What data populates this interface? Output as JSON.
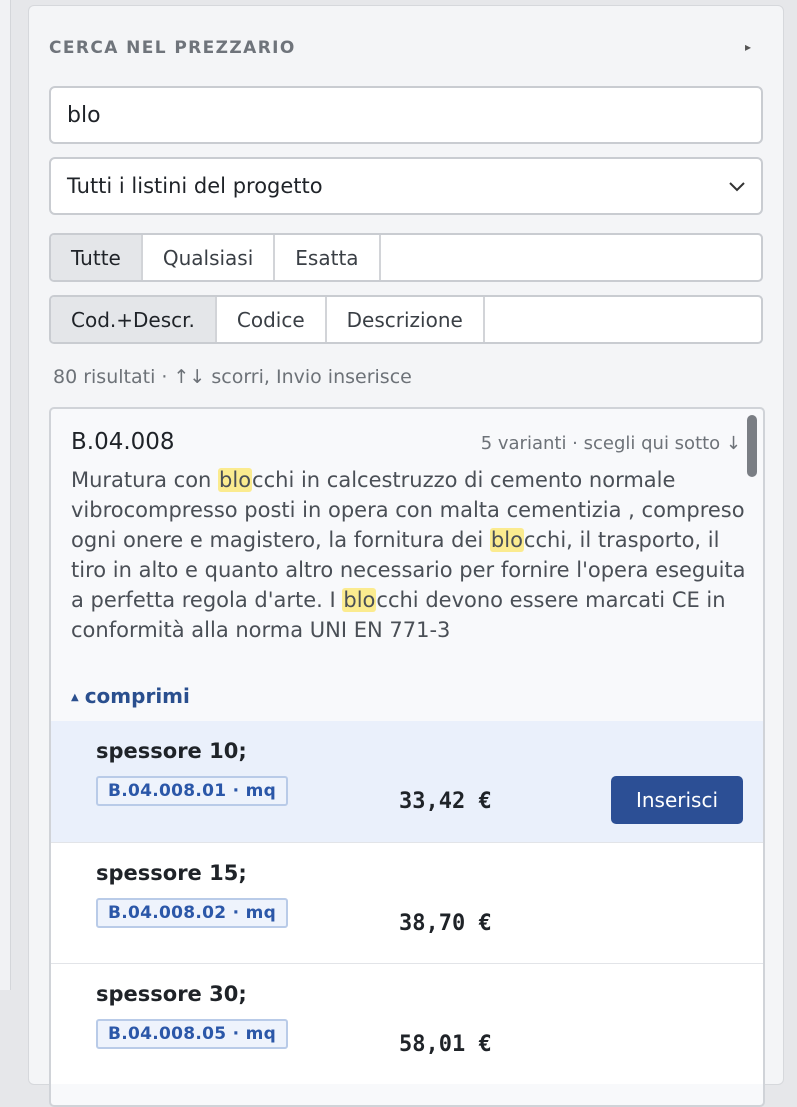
{
  "panel": {
    "title": "CERCA NEL PREZZARIO",
    "toggle_icon": "▸"
  },
  "search": {
    "value": "blo"
  },
  "listino_select": {
    "selected": "Tutti i listini del progetto"
  },
  "match_mode": {
    "options": [
      "Tutte",
      "Qualsiasi",
      "Esatta"
    ],
    "active": "Tutte"
  },
  "search_field": {
    "options": [
      "Cod.+Descr.",
      "Codice",
      "Descrizione"
    ],
    "active": "Cod.+Descr."
  },
  "results": {
    "summary": "80 risultati · ↑↓ scorri, Invio inserisce"
  },
  "item": {
    "code": "B.04.008",
    "variants_hint": "5 varianti · scegli qui sotto ↓",
    "desc_parts": [
      "Muratura con ",
      "blo",
      "cchi in calcestruzzo di cemento normale vibrocompresso posti in opera con malta cementizia , compreso ogni onere e magistero, la fornitura dei ",
      "blo",
      "cchi, il trasporto, il tiro in alto e quanto altro necessario per fornire l'opera eseguita a perfetta regola d'arte. I ",
      "blo",
      "cchi devono essere marcati CE in conformità alla norma UNI EN 771-3"
    ],
    "collapse_label": "comprimi",
    "variants": [
      {
        "label": "spessore 10;",
        "code": "B.04.008.01 · mq",
        "price": "33,42 €",
        "selected": true
      },
      {
        "label": "spessore 15;",
        "code": "B.04.008.02 · mq",
        "price": "38,70 €",
        "selected": false
      },
      {
        "label": "spessore 30;",
        "code": "B.04.008.05 · mq",
        "price": "58,01 €",
        "selected": false
      }
    ],
    "insert_label": "Inserisci"
  },
  "colors": {
    "accent": "#2c4f95",
    "highlight": "#fbeb8f",
    "selected_row": "#eaf0fb"
  }
}
